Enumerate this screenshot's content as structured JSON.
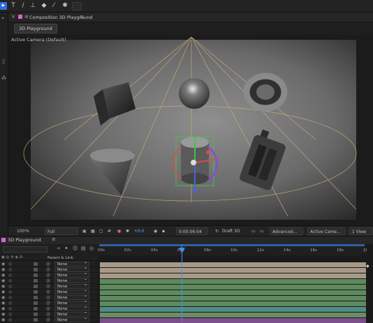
{
  "toolbar": {
    "tools": [
      "selection-tool",
      "text-tool",
      "brush-tool",
      "clone-stamp-tool",
      "eraser-tool",
      "roto-brush-tool",
      "puppet-pin-tool"
    ]
  },
  "composition": {
    "panel_title": "Composition 3D Playground",
    "tab_label": "3D Playground",
    "camera_label": "Active Camera (Default)"
  },
  "viewer_bar": {
    "zoom": "100",
    "zoom_unit": "%",
    "resolution": "Full",
    "exposure": "+0.0",
    "timecode": "0:00:06:04",
    "renderer": "Draft 3D",
    "renderer_options": "Advanced...",
    "camera": "Active Came...",
    "views": "1 View"
  },
  "timeline": {
    "tab_label": "3D Playground",
    "column_parent": "Parent & Link",
    "ruler": [
      "00s",
      "02s",
      "04s",
      "06s",
      "08s",
      "10s",
      "12s",
      "14s",
      "16s",
      "18s",
      "2("
    ],
    "parent_values": [
      "None",
      "None",
      "None",
      "None",
      "None",
      "None",
      "None",
      "None",
      "None",
      "None",
      "None"
    ],
    "bar_colors": [
      "#a89a88",
      "#a89a88",
      "#a89a88",
      "#5e8a5e",
      "#5e8a5e",
      "#5e8a5e",
      "#5e8a5e",
      "#5e8a5e",
      "#4f8d86",
      "#6b8c68",
      "#7a4f8a"
    ]
  }
}
